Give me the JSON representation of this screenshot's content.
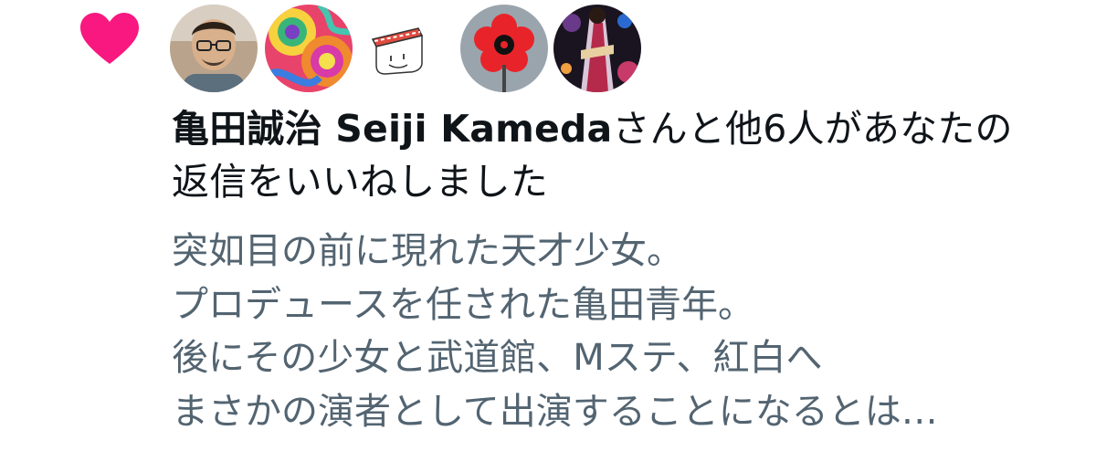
{
  "notification": {
    "type_icon": "heart-icon",
    "accent_color": "#f91880",
    "avatars": [
      {
        "icon": "avatar-man-glasses"
      },
      {
        "icon": "avatar-psychedelic-swirl"
      },
      {
        "icon": "avatar-sushi-drawing"
      },
      {
        "icon": "avatar-red-flower"
      },
      {
        "icon": "avatar-kimono-night"
      }
    ],
    "headline": {
      "name": "亀田誠治 Seiji Kameda",
      "text_line1": "さんと他6人があなたの",
      "text_line2": "返信をいいねしました"
    },
    "tweet_lines": [
      "突如目の前に現れた天才少女。",
      "プロデュースを任された亀田青年。",
      "後にその少女と武道館、Mステ、紅白へ",
      "まさかの演者として出演することになるとは…"
    ]
  }
}
